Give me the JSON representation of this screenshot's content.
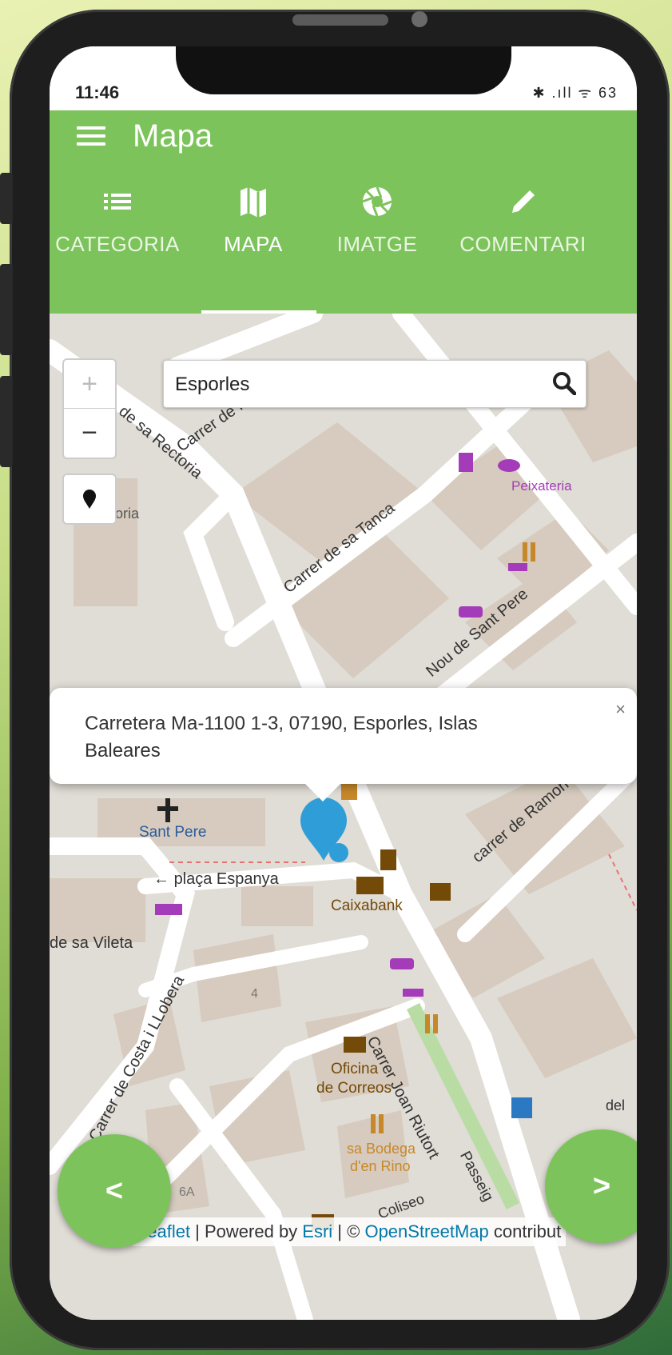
{
  "status": {
    "time": "11:46",
    "icons": "✱ .ıll ᯤ 63"
  },
  "appbar": {
    "title": "Mapa"
  },
  "tabs": [
    {
      "label": "CATEGORIA",
      "icon": "list-icon"
    },
    {
      "label": "MAPA",
      "icon": "map-icon"
    },
    {
      "label": "IMATGE",
      "icon": "aperture-icon"
    },
    {
      "label": "COMENTARI",
      "icon": "pencil-icon"
    }
  ],
  "map": {
    "zoom_in": "+",
    "zoom_out": "−",
    "search_value": "Esporles",
    "labels": {
      "rectoria": "de sa Rectoria",
      "carrer_fr": "Carrer de Fr",
      "oria": "oria",
      "tanca": "Carrer de sa Tanca",
      "peixateria": "Peixateria",
      "sant_pere_street": "Nou de Sant Pere",
      "sant_pere": "Sant Pere",
      "placa": "plaça Espanya",
      "caixabank": "Caixabank",
      "ramon_llull": "carrer de Ramon Llull",
      "vileta": "de sa Vileta",
      "costa": "Carrer de Costa i LLobera",
      "oficina": "Oficina",
      "correos": "de Correos",
      "joan_riutort": "Carrer Joan Riutort",
      "bodega1": "sa Bodega",
      "bodega2": "d'en Rino",
      "passeig": "Passeig",
      "coliseo": "Coliseo",
      "num4": "4",
      "num6a": "6A",
      "del": "del"
    },
    "popup": {
      "text": "Carretera Ma-1100 1-3, 07190, Esporles, Islas Baleares",
      "close": "×"
    },
    "attribution": {
      "leaflet": "Leaflet",
      "sep1": " | Powered by ",
      "esri": "Esri",
      "sep2": " | © ",
      "osm": "OpenStreetMap",
      "tail": " contribut"
    }
  },
  "nav": {
    "prev": "<",
    "next": ">"
  },
  "colors": {
    "accent": "#7dc35b",
    "marker": "#2f9ed8",
    "poi_purple": "#a43bb8",
    "poi_orange": "#c7882a"
  }
}
